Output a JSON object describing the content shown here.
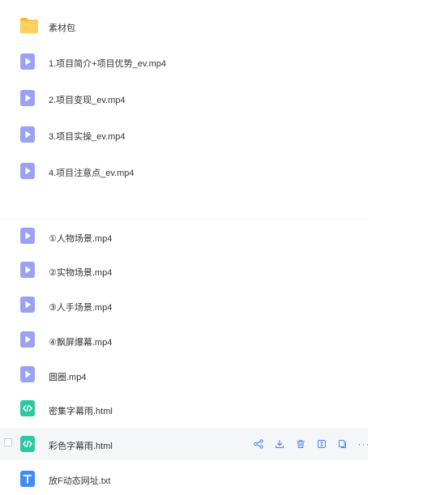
{
  "files": [
    {
      "name": "素材包",
      "type": "folder"
    },
    {
      "name": "1.项目简介+项目优势_ev.mp4",
      "type": "video"
    },
    {
      "name": "2.项目变现_ev.mp4",
      "type": "video"
    },
    {
      "name": "3.项目实操_ev.mp4",
      "type": "video"
    },
    {
      "name": "4.项目注意点_ev.mp4",
      "type": "video"
    },
    {
      "name": "①人物场景.mp4",
      "type": "video"
    },
    {
      "name": "②实物场景.mp4",
      "type": "video"
    },
    {
      "name": "③人手场景.mp4",
      "type": "video"
    },
    {
      "name": "④飘屏爆幕.mp4",
      "type": "video"
    },
    {
      "name": "圆圈.mp4",
      "type": "video"
    },
    {
      "name": "密集字幕雨.html",
      "type": "html"
    },
    {
      "name": "彩色字幕雨.html",
      "type": "html"
    },
    {
      "name": "放F动态网址.txt",
      "type": "txt"
    }
  ],
  "row_actions": {
    "more_label": "···",
    "icons": [
      "share-icon",
      "download-icon",
      "delete-icon",
      "rename-icon",
      "copy-icon",
      "more-icon"
    ]
  },
  "colors": {
    "folder": "#ffc94d",
    "video": "#9aa2f5",
    "html": "#2fc7a0",
    "txt": "#3f8cf6",
    "action": "#4a7ff6",
    "hover_bg": "#f5f6f8"
  }
}
